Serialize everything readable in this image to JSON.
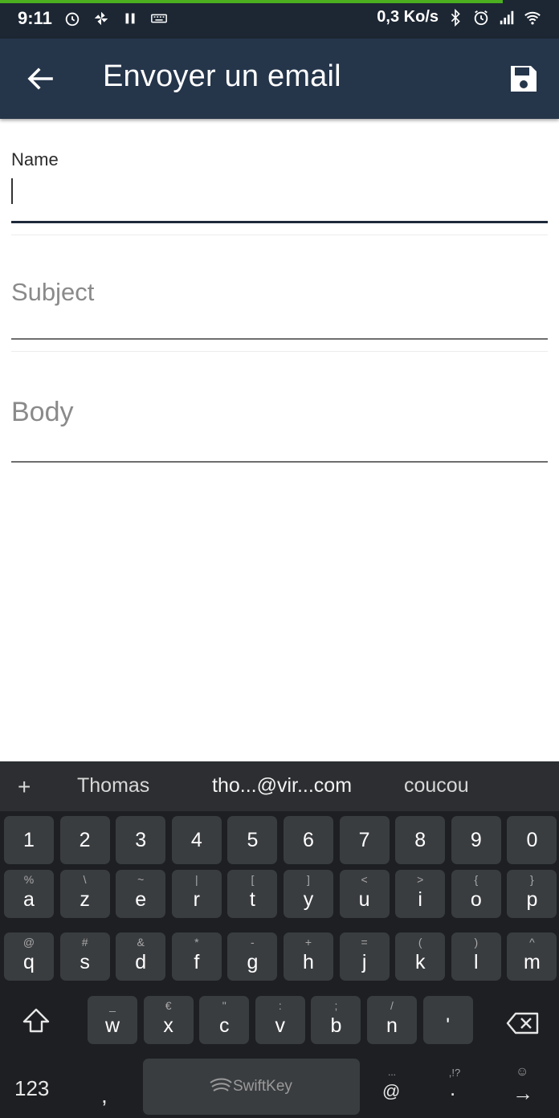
{
  "status_bar": {
    "time": "9:11",
    "net_speed": "0,3 Ko/s",
    "progress_fraction": 0.9
  },
  "app_bar": {
    "title": "Envoyer un email"
  },
  "form": {
    "name_label": "Name",
    "name_value": "",
    "subject_placeholder": "Subject",
    "body_placeholder": "Body"
  },
  "keyboard": {
    "suggestions": [
      "Thomas",
      "tho...@vir...com",
      "coucou"
    ],
    "plus_label": "+",
    "number_row": [
      "1",
      "2",
      "3",
      "4",
      "5",
      "6",
      "7",
      "8",
      "9",
      "0"
    ],
    "row1": [
      {
        "main": "a",
        "alt": "%"
      },
      {
        "main": "z",
        "alt": "\\"
      },
      {
        "main": "e",
        "alt": "~"
      },
      {
        "main": "r",
        "alt": "|"
      },
      {
        "main": "t",
        "alt": "["
      },
      {
        "main": "y",
        "alt": "]"
      },
      {
        "main": "u",
        "alt": "<"
      },
      {
        "main": "i",
        "alt": ">"
      },
      {
        "main": "o",
        "alt": "{"
      },
      {
        "main": "p",
        "alt": "}"
      }
    ],
    "row2": [
      {
        "main": "q",
        "alt": "@"
      },
      {
        "main": "s",
        "alt": "#"
      },
      {
        "main": "d",
        "alt": "&"
      },
      {
        "main": "f",
        "alt": "*"
      },
      {
        "main": "g",
        "alt": "-"
      },
      {
        "main": "h",
        "alt": "+"
      },
      {
        "main": "j",
        "alt": "="
      },
      {
        "main": "k",
        "alt": "("
      },
      {
        "main": "l",
        "alt": ")"
      },
      {
        "main": "m",
        "alt": "^"
      }
    ],
    "row3": [
      {
        "main": "w",
        "alt": "_"
      },
      {
        "main": "x",
        "alt": "€"
      },
      {
        "main": "c",
        "alt": "\""
      },
      {
        "main": "v",
        "alt": ":"
      },
      {
        "main": "b",
        "alt": ";"
      },
      {
        "main": "n",
        "alt": "/"
      },
      {
        "main": "'",
        "alt": ""
      }
    ],
    "numbers_key": "123",
    "comma_key": ",",
    "space_brand": "SwiftKey",
    "at_key": "@",
    "at_alt": "...",
    "period_key": ".",
    "period_alt": ",!?",
    "enter_alt": "☺",
    "enter_key": "→"
  },
  "icons": {
    "back": "arrow-left-icon",
    "save": "floppy-disk-icon",
    "shift": "shift-icon",
    "backspace": "backspace-icon"
  },
  "colors": {
    "app_bar": "#25354a",
    "status_bar": "#1d2733",
    "progress": "#4caf1f",
    "keyboard_bg": "#1d1f22",
    "key_bg": "#3a3d40"
  }
}
